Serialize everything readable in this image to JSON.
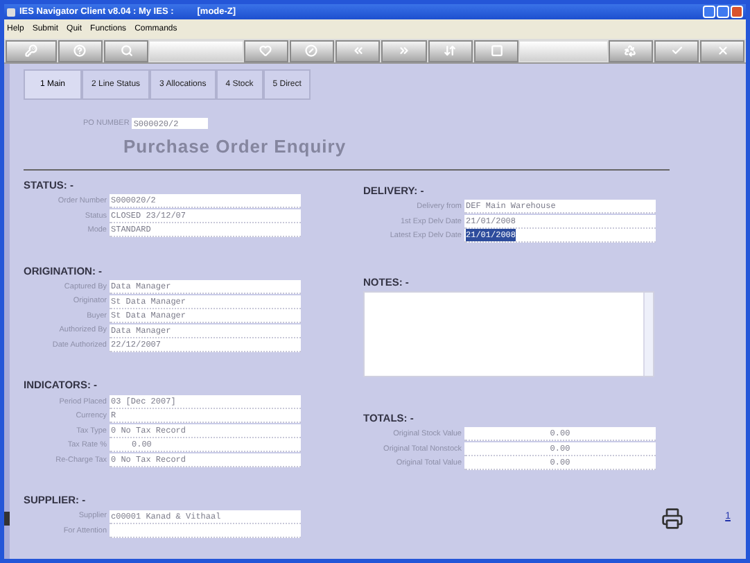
{
  "window": {
    "title": "IES Navigator Client v8.04 : My IES :",
    "mode": "[mode-Z]"
  },
  "menu": [
    "Help",
    "Submit",
    "Quit",
    "Functions",
    "Commands"
  ],
  "tabs": [
    {
      "label": "1 Main",
      "selected": true
    },
    {
      "label": "2 Line Status",
      "selected": false
    },
    {
      "label": "3 Allocations",
      "selected": false
    },
    {
      "label": "4 Stock",
      "selected": false
    },
    {
      "label": "5 Direct",
      "selected": false
    }
  ],
  "po_number": {
    "label": "PO NUMBER",
    "value": "S000020/2"
  },
  "heading": "Purchase Order Enquiry",
  "left_sections": [
    {
      "title": "STATUS: -",
      "fields": [
        {
          "label": "Order Number",
          "value": "S000020/2",
          "kind": "text"
        },
        {
          "label": "Status",
          "value": "CLOSED 23/12/07",
          "kind": "text"
        },
        {
          "label": "Mode",
          "value": "STANDARD",
          "kind": "text"
        }
      ]
    },
    {
      "title": "ORIGINATION: -",
      "fields": [
        {
          "label": "Captured By",
          "value": "Data Manager",
          "kind": "text"
        },
        {
          "label": "Originator",
          "value": "St Data Manager",
          "kind": "text"
        },
        {
          "label": "Buyer",
          "value": "St Data Manager",
          "kind": "text"
        },
        {
          "label": "Authorized By",
          "value": "Data Manager",
          "kind": "text"
        },
        {
          "label": "Date Authorized",
          "value": "22/12/2007",
          "kind": "text"
        }
      ]
    },
    {
      "title": "INDICATORS: -",
      "fields": [
        {
          "label": "Period Placed",
          "value": "03  [Dec 2007]",
          "kind": "text"
        },
        {
          "label": "Currency",
          "value": "R",
          "kind": "text"
        },
        {
          "label": "Tax Type",
          "value": "0 No Tax Record",
          "kind": "text"
        },
        {
          "label": "Tax Rate %",
          "value": "0.00",
          "kind": "amount"
        },
        {
          "label": "Re-Charge Tax",
          "value": "0 No Tax Record",
          "kind": "text"
        }
      ]
    },
    {
      "title": "SUPPLIER: -",
      "fields": [
        {
          "label": "Supplier",
          "value": "c00001 Kanad & Vithaal",
          "kind": "text"
        },
        {
          "label": "For Attention",
          "kind": "text"
        }
      ]
    }
  ],
  "delivery": {
    "title": "DELIVERY: -",
    "fields": [
      {
        "label": "Delivery from",
        "value": "DEF Main Warehouse",
        "selected": false
      },
      {
        "label": "1st Exp Delv Date",
        "value": "21/01/2008",
        "selected": false
      },
      {
        "label": "Latest Exp Delv Date",
        "value": "21/01/2008",
        "selected": true
      }
    ]
  },
  "notes": {
    "title": "NOTES: -"
  },
  "totals": {
    "title": "TOTALS: -",
    "fields": [
      {
        "label": "Original Stock Value",
        "value": "0.00"
      },
      {
        "label": "Original Total Nonstock",
        "value": "0.00"
      },
      {
        "label": "Original Total Value",
        "value": "0.00"
      }
    ]
  },
  "page_number": "1"
}
